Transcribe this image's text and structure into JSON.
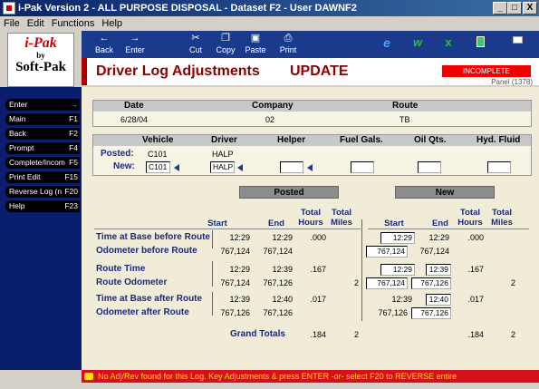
{
  "window": {
    "title": "i-Pak Version 2 - ALL PURPOSE DISPOSAL - Dataset F2 - User DAWNF2",
    "min": "_",
    "max": "□",
    "close": "X"
  },
  "menu": [
    "File",
    "Edit",
    "Functions",
    "Help"
  ],
  "logo": {
    "line1": "i-Pak",
    "line2": "by",
    "line3": "Soft-Pak"
  },
  "toolbar": [
    {
      "label": "Back",
      "icon": "back-arrow-icon",
      "glyph": "←"
    },
    {
      "label": "Enter",
      "icon": "enter-arrow-icon",
      "glyph": "→"
    },
    {
      "label": "Cut",
      "icon": "scissors-icon",
      "glyph": "✂"
    },
    {
      "label": "Copy",
      "icon": "copy-icon",
      "glyph": "❐"
    },
    {
      "label": "Paste",
      "icon": "paste-icon",
      "glyph": "▣"
    },
    {
      "label": "Print",
      "icon": "printer-icon",
      "glyph": "⎙"
    }
  ],
  "header": {
    "title": "Driver Log Adjustments",
    "mode": "UPDATE",
    "status": "INCOMPLETE",
    "panel": "Panel (1378)"
  },
  "nav": [
    {
      "label": "Enter",
      "key": "→"
    },
    {
      "label": "Main",
      "key": "F1"
    },
    {
      "label": "Back",
      "key": "F2"
    },
    {
      "label": "Prompt",
      "key": "F4"
    },
    {
      "label": "Complete/Incom",
      "key": "F5"
    },
    {
      "label": "Print Edit",
      "key": "F15"
    },
    {
      "label": "Reverse Log (n",
      "key": "F20"
    },
    {
      "label": "Help",
      "key": "F23"
    }
  ],
  "summary": {
    "headers": [
      "Date",
      "Company",
      "Route"
    ],
    "values": [
      "6/28/04",
      "02",
      "TB"
    ]
  },
  "crew": {
    "headers": [
      "Vehicle",
      "Driver",
      "Helper",
      "Fuel Gals.",
      "Oil Qts.",
      "Hyd. Fluid"
    ],
    "posted_label": "Posted:",
    "new_label": "New:",
    "posted": {
      "vehicle": "C101",
      "driver": "HALP"
    },
    "new": {
      "vehicle": "C101",
      "driver": "HALP",
      "helper": "",
      "fuel": "",
      "oil": "",
      "hyd": ""
    }
  },
  "times": {
    "posted_title": "Posted",
    "new_title": "New",
    "col_start": "Start",
    "col_end": "End",
    "col_hours": "Total Hours",
    "col_miles": "Total Miles",
    "rows": [
      {
        "label": "Time at Base before Route",
        "p_start": "12:29",
        "p_end": "12:29",
        "p_hours": ".000",
        "p_miles": "",
        "n_start": "12:29",
        "n_end": "12:29",
        "n_hours": ".000",
        "n_miles": ""
      },
      {
        "label": "Odometer before Route",
        "p_start": "767,124",
        "p_end": "767,124",
        "p_hours": "",
        "p_miles": "",
        "n_start": "767,124",
        "n_end": "767,124",
        "n_hours": "",
        "n_miles": ""
      },
      {
        "label": "Route Time",
        "p_start": "12:29",
        "p_end": "12:39",
        "p_hours": ".167",
        "p_miles": "",
        "n_start": "12:29",
        "n_end": "12:39",
        "n_hours": ".167",
        "n_miles": ""
      },
      {
        "label": "Route Odometer",
        "p_start": "767,124",
        "p_end": "767,126",
        "p_hours": "",
        "p_miles": "2",
        "n_start": "767,124",
        "n_end": "767,126",
        "n_hours": "",
        "n_miles": "2"
      },
      {
        "label": "Time at Base after Route",
        "p_start": "12:39",
        "p_end": "12:40",
        "p_hours": ".017",
        "p_miles": "",
        "n_start": "12:39",
        "n_end": "12:40",
        "n_hours": ".017",
        "n_miles": ""
      },
      {
        "label": "Odometer after Route",
        "p_start": "767,126",
        "p_end": "767,126",
        "p_hours": "",
        "p_miles": "",
        "n_start": "767,126",
        "n_end": "767,126",
        "n_hours": "",
        "n_miles": ""
      }
    ],
    "totals": {
      "label": "Grand Totals",
      "p_hours": ".184",
      "p_miles": "2",
      "n_hours": ".184",
      "n_miles": "2"
    }
  },
  "status_message": "No Adj/Rev found for this Log. Key Adjustments & press ENTER  -or-  select F20 to REVERSE entire"
}
